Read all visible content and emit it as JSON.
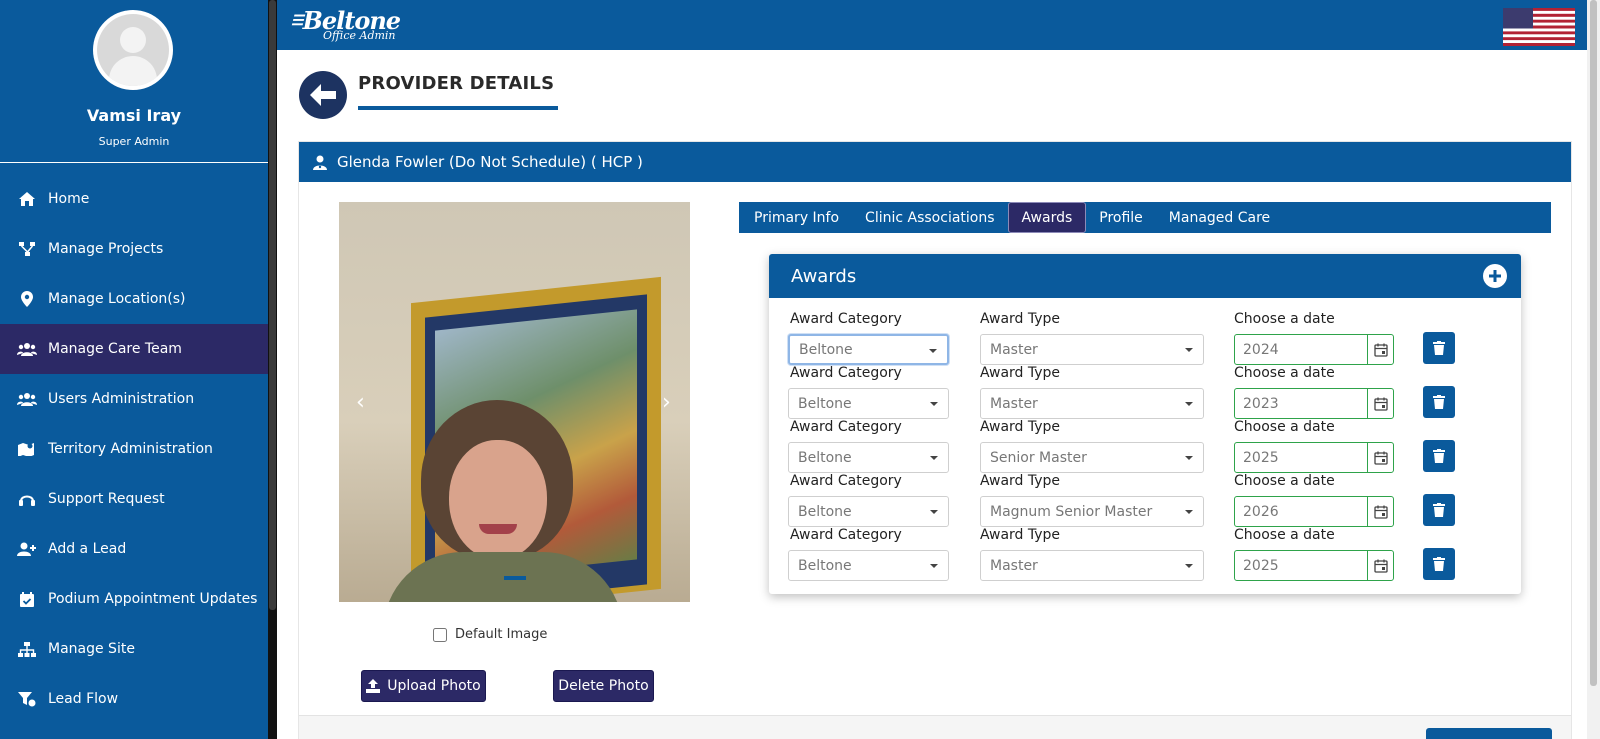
{
  "sidebar": {
    "user_name": "Vamsi Iray",
    "user_role": "Super Admin",
    "items": [
      {
        "label": "Home",
        "icon": "home-icon"
      },
      {
        "label": "Manage Projects",
        "icon": "project-icon"
      },
      {
        "label": "Manage Location(s)",
        "icon": "location-pin-icon"
      },
      {
        "label": "Manage Care Team",
        "icon": "users-icon",
        "active": true
      },
      {
        "label": "Users Administration",
        "icon": "users-icon"
      },
      {
        "label": "Territory Administration",
        "icon": "map-icon"
      },
      {
        "label": "Support Request",
        "icon": "headset-icon"
      },
      {
        "label": "Add a Lead",
        "icon": "user-plus-icon"
      },
      {
        "label": "Podium Appointment Updates",
        "icon": "calendar-check-icon"
      },
      {
        "label": "Manage Site",
        "icon": "sitemap-icon"
      },
      {
        "label": "Lead Flow",
        "icon": "funnel-icon"
      }
    ]
  },
  "header": {
    "brand": "Beltone",
    "brand_sub": "Office Admin",
    "flag": "us-flag-icon"
  },
  "page": {
    "title": "PROVIDER DETAILS"
  },
  "provider": {
    "header": "Glenda Fowler (Do Not Schedule) ( HCP )",
    "default_image_label": "Default Image",
    "upload_label": "Upload Photo",
    "delete_label": "Delete Photo"
  },
  "tabs": [
    {
      "label": "Primary Info"
    },
    {
      "label": "Clinic Associations"
    },
    {
      "label": "Awards",
      "active": true
    },
    {
      "label": "Profile"
    },
    {
      "label": "Managed Care"
    }
  ],
  "awards": {
    "title": "Awards",
    "labels": {
      "category": "Award Category",
      "type": "Award Type",
      "date": "Choose a date"
    },
    "rows": [
      {
        "category": "Beltone",
        "type": "Master",
        "date": "2024"
      },
      {
        "category": "Beltone",
        "type": "Master",
        "date": "2023"
      },
      {
        "category": "Beltone",
        "type": "Senior Master",
        "date": "2025"
      },
      {
        "category": "Beltone",
        "type": "Magnum Senior Master",
        "date": "2026"
      },
      {
        "category": "Beltone",
        "type": "Master",
        "date": "2025"
      }
    ]
  },
  "colors": {
    "primary": "#0a5a9c",
    "active": "#2c2966",
    "date_border": "#2ea34a"
  }
}
